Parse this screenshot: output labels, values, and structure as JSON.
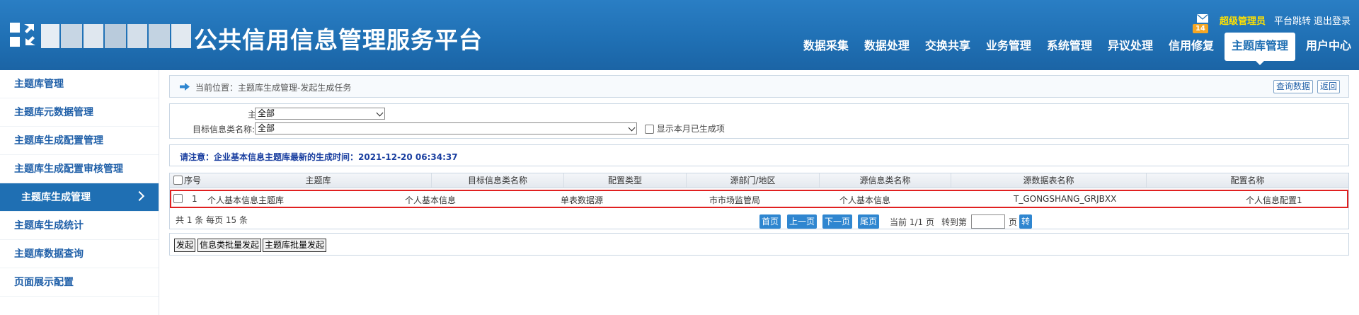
{
  "header": {
    "title": "公共信用信息管理服务平台",
    "mail_badge": "14",
    "user_name": "超级管理员",
    "links": [
      "平台跳转",
      "退出登录"
    ],
    "nav": [
      "数据采集",
      "数据处理",
      "交换共享",
      "业务管理",
      "系统管理",
      "异议处理",
      "信用修复",
      "主题库管理",
      "用户中心"
    ],
    "active_nav": "主题库管理",
    "colors": {
      "header_bg": "#1f6fb3",
      "user_name": "#ffe100",
      "badge": "#f5a623"
    }
  },
  "sidebar": {
    "items": [
      "主题库管理",
      "主题库元数据管理",
      "主题库生成配置管理",
      "主题库生成配置审核管理",
      "主题库生成管理",
      "主题库生成统计",
      "主题库数据查询",
      "页面展示配置"
    ],
    "active": "主题库生成管理"
  },
  "breadcrumb": {
    "text": "当前位置：主题库生成管理-发起生成任务",
    "buttons": [
      "查询数据",
      "返回"
    ]
  },
  "filters": {
    "theme_label": "主题库:",
    "theme_value": "全部",
    "target_label": "目标信息类名称:",
    "target_value": "全部",
    "show_generated_label": "显示本月已生成项"
  },
  "notice": "请注意：企业基本信息主题库最新的生成时间：2021-12-20 06:34:37",
  "table": {
    "columns": [
      "序号",
      "主题库",
      "目标信息类名称",
      "配置类型",
      "源部门/地区",
      "源信息类名称",
      "源数据表名称",
      "配置名称"
    ],
    "rows": [
      [
        "1",
        "个人基本信息主题库",
        "个人基本信息",
        "单表数据源",
        "市市场监管局",
        "个人基本信息",
        "T_GONGSHANG_GRJBXX",
        "个人信息配置1"
      ]
    ]
  },
  "pager": {
    "info": "共 1 条  每页 15  条",
    "buttons": [
      "首页",
      "上一页",
      "下一页",
      "尾页"
    ],
    "current": "当前 1/1 页",
    "goto_label": "转到第",
    "page_unit": "页",
    "go": "转"
  },
  "actions": [
    "发起",
    "信息类批量发起",
    "主题库批量发起"
  ]
}
